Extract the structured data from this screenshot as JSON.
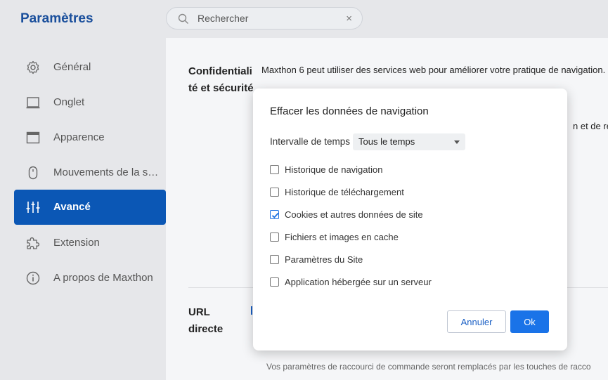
{
  "app": {
    "title": "Paramètres"
  },
  "search": {
    "placeholder": "Rechercher",
    "clear_glyph": "×"
  },
  "sidebar": {
    "items": [
      {
        "label": "Général",
        "icon": "gear-icon"
      },
      {
        "label": "Onglet",
        "icon": "tab-icon"
      },
      {
        "label": "Apparence",
        "icon": "window-icon"
      },
      {
        "label": "Mouvements de la souris",
        "icon": "mouse-icon"
      },
      {
        "label": "Avancé",
        "icon": "sliders-icon",
        "active": true
      },
      {
        "label": "Extension",
        "icon": "puzzle-icon"
      },
      {
        "label": "A propos de Maxthon",
        "icon": "info-icon"
      }
    ]
  },
  "content": {
    "privacy_title_line1": "Confidentiali",
    "privacy_title_line2": "té et sécurité",
    "privacy_text": "Maxthon 6 peut utiliser des services web pour améliorer votre pratique de navigation.",
    "privacy_text_partial": "n et de re",
    "url_title_line1": "URL",
    "url_title_line2": "directe",
    "footer_text": "Vos paramètres de raccourci de commande seront remplacés par les touches de racco"
  },
  "dialog": {
    "title": "Effacer les données de navigation",
    "range_label": "Intervalle de temps",
    "range_value": "Tous le temps",
    "options": [
      {
        "label": "Historique de navigation",
        "checked": false
      },
      {
        "label": "Historique de téléchargement",
        "checked": false
      },
      {
        "label": "Cookies et autres données de site",
        "checked": true
      },
      {
        "label": "Fichiers et images en cache",
        "checked": false
      },
      {
        "label": "Paramètres du Site",
        "checked": false
      },
      {
        "label": "Application hébergée sur un serveur",
        "checked": false
      }
    ],
    "cancel_label": "Annuler",
    "ok_label": "Ok"
  },
  "colors": {
    "accent": "#0b57b5",
    "ok_button": "#1a73e8",
    "title": "#1a4f9c"
  }
}
